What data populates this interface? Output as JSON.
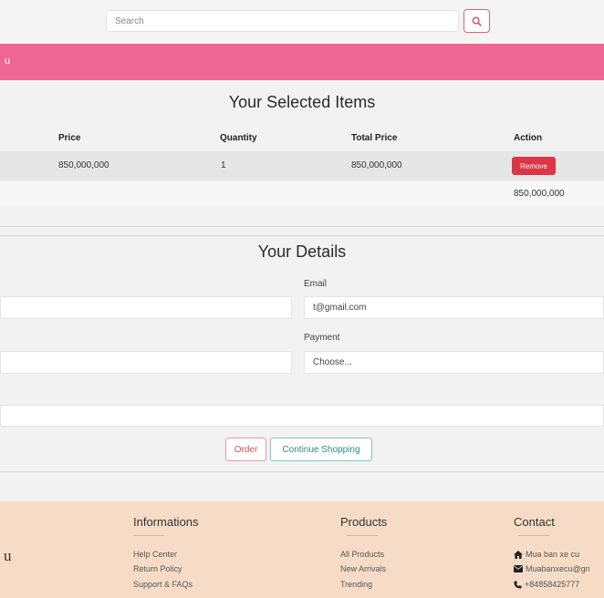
{
  "header": {
    "search_placeholder": "Search",
    "banner_text": "u"
  },
  "cart": {
    "title": "Your Selected Items",
    "columns": [
      "Price",
      "Quantity",
      "Total Price",
      "Action"
    ],
    "rows": [
      {
        "price": "850,000,000",
        "quantity": "1",
        "total_price": "850,000,000",
        "action": "Remove"
      }
    ],
    "grand_total": "850,000,000"
  },
  "details": {
    "title": "Your Details",
    "email_label": "Email",
    "email_value": "t@gmail.com",
    "payment_label": "Payment",
    "payment_value": "Choose...",
    "left_field_1_value": "",
    "left_field_2_value": "",
    "wide_field_value": ""
  },
  "actions": {
    "order_label": "Order",
    "continue_label": "Continue Shopping"
  },
  "footer": {
    "brand_text": "u",
    "informations": {
      "heading": "Informations",
      "links": [
        "Help Center",
        "Return Policy",
        "Support & FAQs"
      ]
    },
    "products": {
      "heading": "Products",
      "links": [
        "All Products",
        "New Arrivals",
        "Trending"
      ]
    },
    "contact": {
      "heading": "Contact",
      "address": "Mua ban xe cu",
      "email": "Muabanxecu@gn",
      "phone": "+84858425777"
    }
  },
  "colors": {
    "accent_pink": "#ee6693",
    "remove_red": "#dc3545",
    "footer_bg": "#f6dcc6"
  }
}
